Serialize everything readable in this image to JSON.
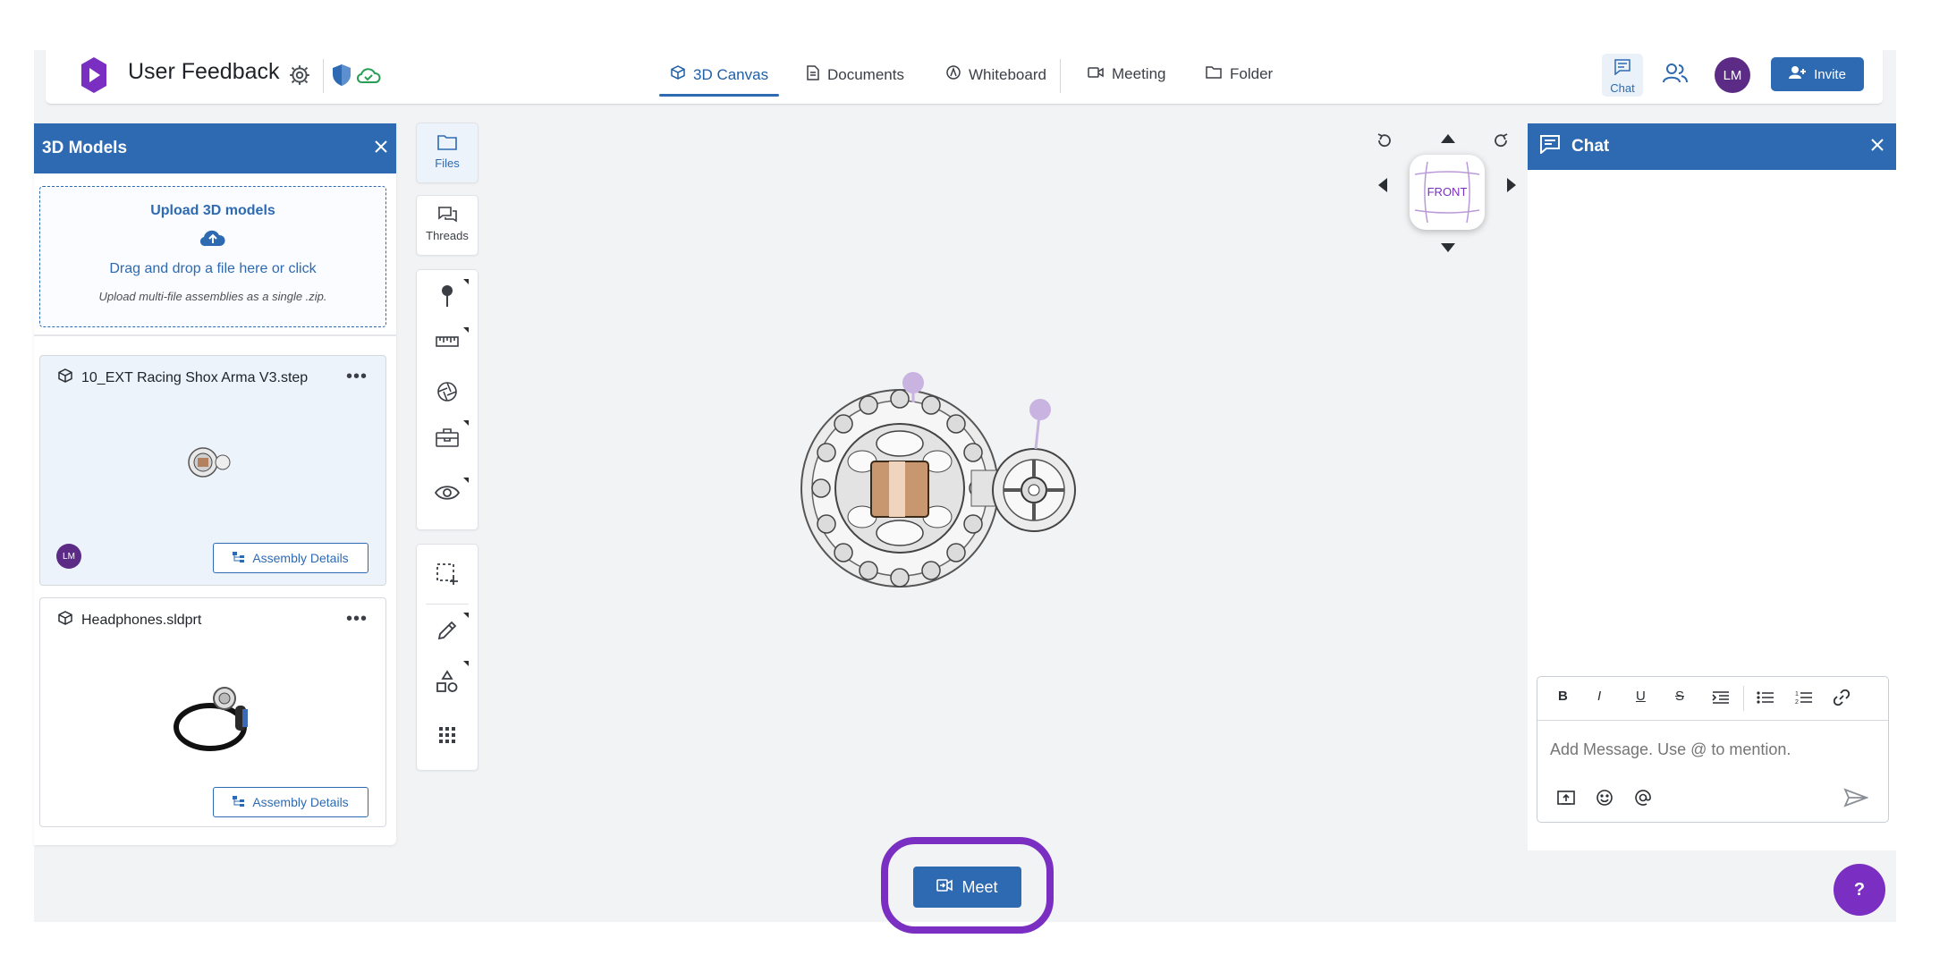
{
  "header": {
    "app_title": "User Feedback",
    "tabs": [
      {
        "label": "3D Canvas",
        "active": true
      },
      {
        "label": "Documents"
      },
      {
        "label": "Whiteboard"
      },
      {
        "label": "Meeting"
      },
      {
        "label": "Folder"
      }
    ],
    "chat_label": "Chat",
    "avatar_initials": "LM",
    "invite_label": "Invite"
  },
  "models_panel": {
    "title": "3D Models",
    "upload": {
      "title": "Upload 3D models",
      "drag_text": "Drag and drop a file here or click",
      "hint": "Upload multi-file assemblies as a single .zip."
    },
    "items": [
      {
        "name": "10_EXT Racing Shox Arma V3.step",
        "owner_initials": "LM",
        "button": "Assembly Details"
      },
      {
        "name": "Headphones.sldprt",
        "button": "Assembly Details"
      }
    ]
  },
  "toolbar": {
    "files_label": "Files",
    "threads_label": "Threads"
  },
  "viewcube": {
    "face_label": "FRONT"
  },
  "chat_panel": {
    "title": "Chat",
    "placeholder": "Add Message. Use @ to mention.",
    "format_buttons": [
      "B",
      "I",
      "U",
      "S"
    ]
  },
  "meet_button": {
    "label": "Meet"
  },
  "help_button": {
    "label": "?"
  },
  "colors": {
    "primary": "#2e6ab2",
    "accent_purple": "#7a2fc2",
    "avatar": "#5b2b86"
  }
}
